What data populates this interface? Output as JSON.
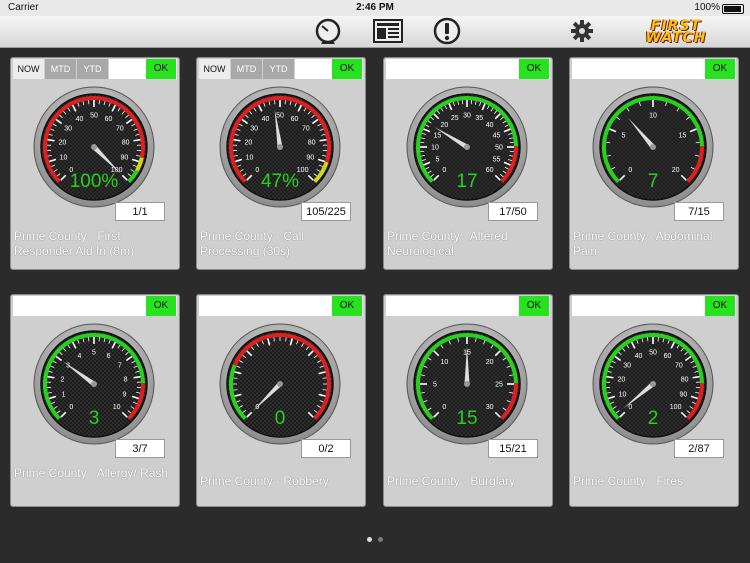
{
  "status": {
    "carrier": "Carrier",
    "time": "2:46 PM",
    "battery": "100%"
  },
  "toolbar": {
    "icons": [
      "speedometer-icon",
      "report-icon",
      "alert-icon"
    ],
    "settings_icon": "gear-icon",
    "logo_line1": "FIRST",
    "logo_line2": "WATCH"
  },
  "colors": {
    "ok_green": "#27e21e",
    "gauge_red": "#e02020",
    "gauge_green": "#29d11f",
    "gauge_yellow": "#d4d41a"
  },
  "cards": [
    {
      "tabs": [
        "NOW",
        "MTD",
        "YTD"
      ],
      "active_tab": "NOW",
      "ok": "OK",
      "ticks": [
        "0",
        "10",
        "20",
        "30",
        "40",
        "50",
        "60",
        "70",
        "80",
        "90",
        "100"
      ],
      "max": 100,
      "value": 100,
      "center": "100%",
      "readout": "1/1",
      "title": "Prime County - First Responder Aid In (8m)",
      "zones": "red-green-yellow"
    },
    {
      "tabs": [
        "NOW",
        "MTD",
        "YTD"
      ],
      "active_tab": "NOW",
      "ok": "OK",
      "ticks": [
        "0",
        "10",
        "20",
        "30",
        "40",
        "50",
        "60",
        "70",
        "80",
        "90",
        "100"
      ],
      "max": 100,
      "value": 47,
      "center": "47%",
      "readout": "105/225",
      "title": "Prime County - Call Processing (30s)",
      "zones": "red-yellow"
    },
    {
      "tabs": [],
      "active_tab": "",
      "ok": "OK",
      "ticks": [
        "0",
        "5",
        "10",
        "15",
        "20",
        "25",
        "30",
        "35",
        "40",
        "45",
        "50",
        "55",
        "60"
      ],
      "max": 60,
      "value": 17,
      "center": "17",
      "readout": "17/50",
      "title": "Prime County - Altered Neurological",
      "zones": "green-red"
    },
    {
      "tabs": [],
      "active_tab": "",
      "ok": "OK",
      "ticks": [
        "0",
        "5",
        "10",
        "15",
        "20"
      ],
      "max": 20,
      "value": 7,
      "center": "7",
      "readout": "7/15",
      "title": "Prime County - Abdominal Pain",
      "zones": "green-red"
    },
    {
      "tabs": [],
      "active_tab": "",
      "ok": "OK",
      "ticks": [
        "0",
        "1",
        "2",
        "3",
        "4",
        "5",
        "6",
        "7",
        "8",
        "9",
        "10"
      ],
      "max": 10,
      "value": 3,
      "center": "3",
      "readout": "3/7",
      "title": "Prime County - Allergy/ Rash",
      "zones": "green-red"
    },
    {
      "tabs": [],
      "active_tab": "",
      "ok": "OK",
      "ticks": [
        "0",
        "",
        "",
        "",
        "",
        "",
        "",
        "",
        "",
        ""
      ],
      "max": 3,
      "value": 0,
      "center": "0",
      "readout": "0/2",
      "title": "Prime County - Robbery",
      "zones": "green-red-small"
    },
    {
      "tabs": [],
      "active_tab": "",
      "ok": "OK",
      "ticks": [
        "0",
        "5",
        "10",
        "15",
        "20",
        "25",
        "30"
      ],
      "max": 30,
      "value": 15,
      "center": "15",
      "readout": "15/21",
      "title": "Prime County - Burglary",
      "zones": "green-red"
    },
    {
      "tabs": [],
      "active_tab": "",
      "ok": "OK",
      "ticks": [
        "0",
        "10",
        "20",
        "30",
        "40",
        "50",
        "60",
        "70",
        "80",
        "90",
        "100"
      ],
      "max": 100,
      "value": 2,
      "center": "2",
      "readout": "2/87",
      "title": "Prime County - Fires",
      "zones": "green-red"
    }
  ],
  "pager": {
    "pages": 2,
    "current": 1
  }
}
